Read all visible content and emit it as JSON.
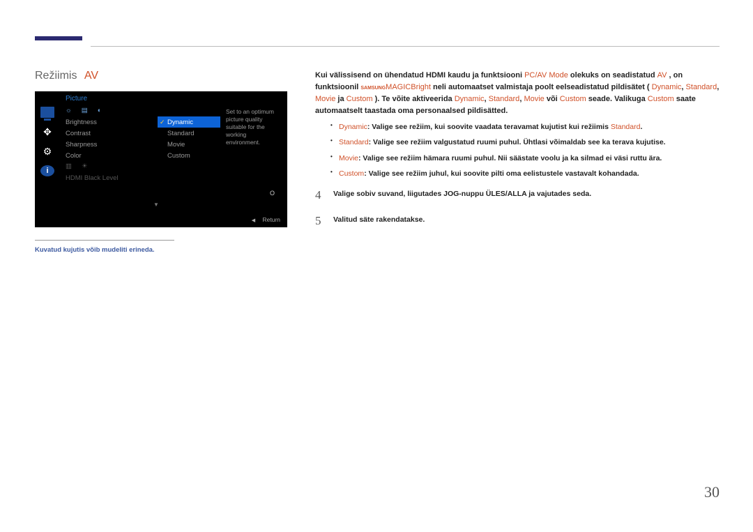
{
  "page_number": "30",
  "heading": {
    "label": "Režiimis",
    "mode": "AV"
  },
  "osd": {
    "title": "Picture",
    "sidebar_icons": [
      "monitor",
      "arrows",
      "gear",
      "info"
    ],
    "col1_iconrow": [
      "brightness-icon",
      "samsung-bright-icon",
      "contrast-icon"
    ],
    "menu_items": [
      "Brightness",
      "Contrast",
      "Sharpness",
      "Color"
    ],
    "dimmed_iconrow": [
      "angle-icon",
      "bright-icon"
    ],
    "dimmed_item": "HDMI Black Level",
    "options": [
      "Dynamic",
      "Standard",
      "Movie",
      "Custom"
    ],
    "selected_option": "Dynamic",
    "description": "Set to an optimum picture quality suitable for the working environment.",
    "right_o": "O",
    "down_arrow": "▼",
    "return": "Return",
    "return_tri": "◀"
  },
  "footnote": "Kuvatud kujutis võib mudeliti erineda.",
  "intro": {
    "l1a": "Kui välissisend on ühendatud HDMI kaudu ja funktsiooni ",
    "l1_pcav": "PC/AV Mode",
    "l1b": " olekuks on seadistatud ",
    "l1_av": "AV",
    "l1c": ", on funktsioonil ",
    "magic_small": "SAMSUNG",
    "magic_bright": "MAGICBright",
    "l2a": " neli automaatset valmistaja poolt eelseadistatud pildisätet (",
    "d": "Dynamic",
    "s": "Standard",
    "m": "Movie",
    "c": "Custom",
    "l2b": "). Te võite aktiveerida ",
    "l2_or": " või ",
    "l2c": " seade. Valikuga ",
    "l2d": " saate automaatselt taastada oma personaalsed pildisätted.",
    "comma": ", ",
    "ja": " ja "
  },
  "bullets": {
    "dynamic_label": "Dynamic",
    "dynamic_text": ": Valige see režiim, kui soovite vaadata teravamat kujutist kui režiimis ",
    "dynamic_end": "Standard",
    "dynamic_dot": ".",
    "standard_label": "Standard",
    "standard_text": ": Valige see režiim valgustatud ruumi puhul. Ühtlasi võimaldab see ka terava kujutise.",
    "movie_label": "Movie",
    "movie_text": ": Valige see režiim hämara ruumi puhul. Nii säästate voolu ja ka silmad ei väsi ruttu ära.",
    "custom_label": "Custom",
    "custom_text": ": Valige see režiim juhul, kui soovite pilti oma eelistustele vastavalt kohandada."
  },
  "steps": {
    "n4": "4",
    "t4": "Valige sobiv suvand, liigutades JOG-nuppu ÜLES/ALLA ja vajutades seda.",
    "n5": "5",
    "t5": "Valitud säte rakendatakse."
  }
}
